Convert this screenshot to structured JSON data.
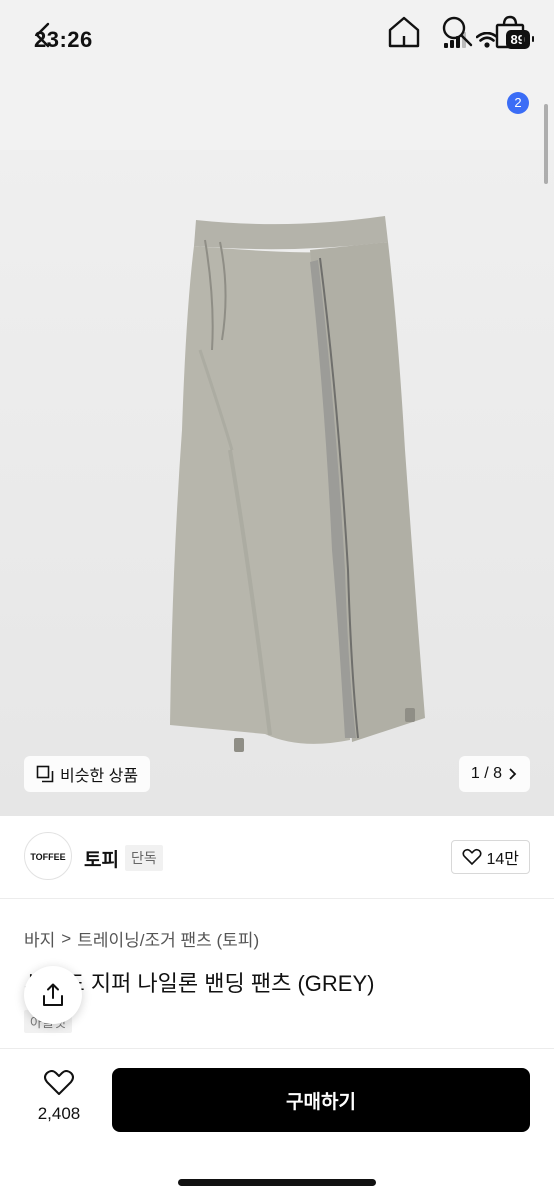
{
  "status_bar": {
    "time": "23:26",
    "battery": "89"
  },
  "nav": {
    "cart_count": "2"
  },
  "gallery": {
    "similar_label": "비슷한 상품",
    "page_counter": "1 / 8"
  },
  "brand": {
    "logo_text": "TOFFEE",
    "name": "토피",
    "tag": "단독",
    "likes": "14만"
  },
  "breadcrumb": {
    "level1": "바지",
    "separator": ">",
    "level2": "트레이닝/조거 팬츠 (토피)"
  },
  "product": {
    "title": "사이드 지퍼 나일론 밴딩 팬츠 (GREY)",
    "sub_tag": "아울렛"
  },
  "bottom_bar": {
    "wish_count": "2,408",
    "buy_label": "구매하기"
  },
  "colors": {
    "accent": "#3b6df6",
    "pants": "#b7b6ac",
    "buy_button": "#000000"
  }
}
